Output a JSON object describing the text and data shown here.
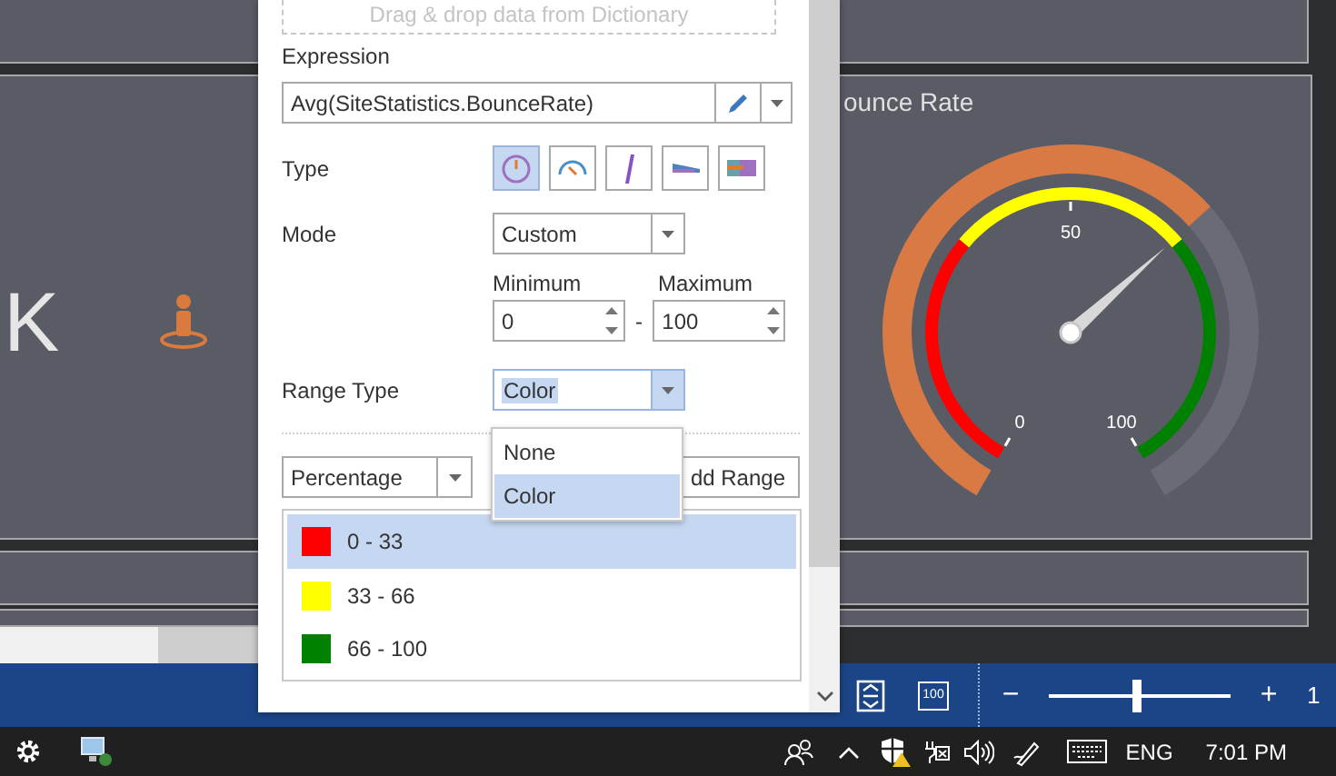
{
  "dashboard": {
    "kpi": {
      "value": "K"
    },
    "gauge": {
      "title": "ounce Rate",
      "level": 0.66,
      "ticks": [
        "0",
        "50",
        "100"
      ]
    }
  },
  "panel": {
    "drop_hint": "Drag & drop data from Dictionary",
    "expression": {
      "label": "Expression",
      "value": "Avg(SiteStatistics.BounceRate)"
    },
    "type": {
      "label": "Type",
      "options": [
        {
          "kind": "circle",
          "selected": true
        },
        {
          "kind": "arc",
          "selected": false
        },
        {
          "kind": "needle",
          "selected": false
        },
        {
          "kind": "wedge",
          "selected": false
        },
        {
          "kind": "bars",
          "selected": false
        }
      ]
    },
    "mode": {
      "label": "Mode",
      "value": "Custom"
    },
    "minimum": {
      "label": "Minimum",
      "value": "0"
    },
    "maximum": {
      "label": "Maximum",
      "value": "100"
    },
    "separator": "-",
    "range_type": {
      "label": "Range Type",
      "value": "Color",
      "options": [
        {
          "label": "None",
          "selected": false
        },
        {
          "label": "Color",
          "selected": true
        }
      ]
    },
    "range_mode": {
      "value": "Percentage"
    },
    "add_range_button": "dd Range",
    "ranges": [
      {
        "label": "0 - 33",
        "color": "#ff0000",
        "selected": true
      },
      {
        "label": "33 - 66",
        "color": "#ffff00",
        "selected": false
      },
      {
        "label": "66 - 100",
        "color": "#008000",
        "selected": false
      }
    ]
  },
  "status_bar": {
    "actual_size_button": "100",
    "zoom_out": "−",
    "zoom": {
      "level": 0.48
    },
    "zoom_in": "+",
    "zoom_value": "1"
  },
  "taskbar": {
    "language": "ENG",
    "time": "7:01 PM"
  }
}
